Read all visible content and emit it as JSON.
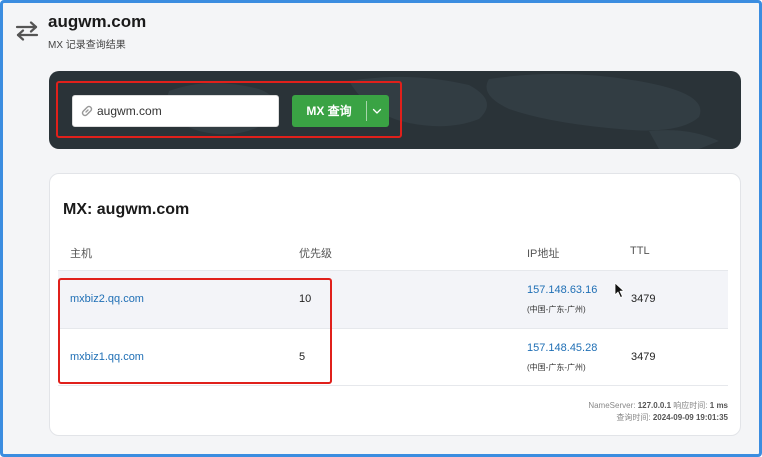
{
  "header": {
    "title": "augwm.com",
    "subtitle": "MX 记录查询结果"
  },
  "search": {
    "value": "augwm.com",
    "button_label": "MX 查询"
  },
  "result": {
    "title": "MX: augwm.com",
    "columns": {
      "host": "主机",
      "priority": "优先级",
      "ip": "IP地址",
      "ttl": "TTL"
    },
    "rows": [
      {
        "host": "mxbiz2.qq.com",
        "priority": "10",
        "ip": "157.148.63.16",
        "location": "(中国-广东-广州)",
        "ttl": "3479"
      },
      {
        "host": "mxbiz1.qq.com",
        "priority": "5",
        "ip": "157.148.45.28",
        "location": "(中国-广东-广州)",
        "ttl": "3479"
      }
    ],
    "footer": {
      "nameserver_label": "NameServer:",
      "nameserver_value": "127.0.0.1",
      "response_label": "响应时间:",
      "response_value": "1 ms",
      "query_time_label": "查询时间:",
      "query_time_value": "2024-09-09 19:01:35"
    }
  },
  "colors": {
    "accent_blue": "#3b8de0",
    "button_green": "#3aa344",
    "highlight_red": "#e0201b",
    "link_blue": "#1f6fb5",
    "panel_dark": "#2a3338"
  },
  "icons": {
    "swap": "swap-arrows-icon",
    "link": "link-icon",
    "caret": "chevron-down-icon",
    "cursor": "mouse-cursor-icon"
  }
}
